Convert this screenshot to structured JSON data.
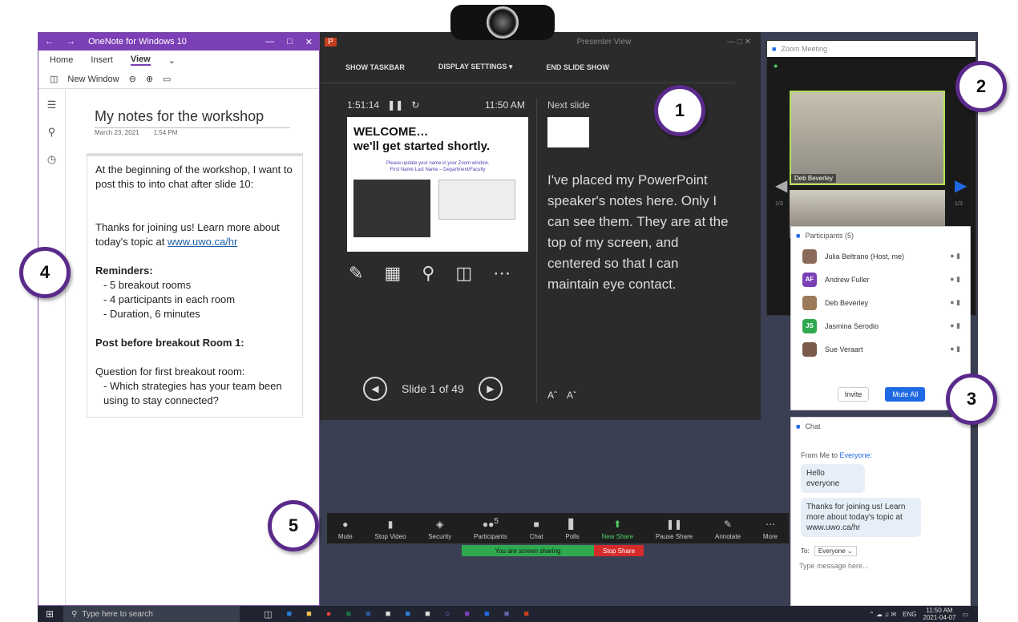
{
  "onenote": {
    "title": "OneNote for Windows 10",
    "menu": [
      "Home",
      "Insert",
      "View"
    ],
    "active_menu": "View",
    "toolbar_new_window": "New Window",
    "note_title": "My notes for the workshop",
    "note_date": "March 23, 2021",
    "note_time": "1:54 PM",
    "body": {
      "p1": "At the beginning of the workshop, I want to post this to into chat after slide 10:",
      "p2a": "Thanks for joining us! Learn more about today's topic at ",
      "p2link": "www.uwo.ca/hr",
      "reminders_heading": "Reminders:",
      "reminders": [
        "5 breakout rooms",
        "4 participants in each room",
        "Duration, 6 minutes"
      ],
      "post_heading": "Post before breakout Room 1:",
      "question_intro": "Question for first breakout room:",
      "questions": [
        "Which strategies has your team been using to stay connected?"
      ]
    }
  },
  "powerpoint": {
    "window_title": "Presenter View",
    "toolbar": [
      "SHOW TASKBAR",
      "DISPLAY SETTINGS ▾",
      "END SLIDE SHOW"
    ],
    "timer": "1:51:14",
    "clock": "11:50 AM",
    "next_slide_label": "Next slide",
    "slide_heading_1": "WELCOME…",
    "slide_heading_2": "we'll get started shortly.",
    "slide_sub_1": "Please update your name in your Zoom window.",
    "slide_sub_2": "First Name Last Name – Department/Faculty",
    "notes": "I've placed my PowerPoint speaker's notes here. Only I can see them. They are at the top of my screen, and centered so that I can maintain eye contact.",
    "slide_counter": "Slide 1 of 49"
  },
  "zoom_meeting": {
    "title": "Zoom Meeting",
    "speaker_name": "Deb Beverley",
    "page_left": "1/3",
    "page_right": "1/3"
  },
  "participants": {
    "title": "Participants (5)",
    "list": [
      {
        "name": "Julia Beltrano (Host, me)",
        "initials": "",
        "color": "#8a6a5a"
      },
      {
        "name": "Andrew Fuller",
        "initials": "AF",
        "color": "#7b3fb6"
      },
      {
        "name": "Deb Beverley",
        "initials": "",
        "color": "#9a7a5a"
      },
      {
        "name": "Jasmina Serodio",
        "initials": "JS",
        "color": "#2fa84f"
      },
      {
        "name": "Sue Veraart",
        "initials": "",
        "color": "#7a5a4a"
      }
    ],
    "invite": "Invite",
    "mute_all": "Mute All"
  },
  "chat": {
    "title": "Chat",
    "from": "From Me to ",
    "to_everyone": "Everyone:",
    "msg1": "Hello everyone",
    "msg2": "Thanks for joining us! Learn more about today's topic at www.uwo.ca/hr",
    "to_label": "To:",
    "to_value": "Everyone ⌄",
    "placeholder": "Type message here..."
  },
  "zoom_toolbar": {
    "buttons": [
      "Mute",
      "Stop Video",
      "Security",
      "Participants",
      "Chat",
      "Polls",
      "New Share",
      "Pause Share",
      "Annotate",
      "More"
    ],
    "participant_count": "5",
    "sharing_text": "You are screen sharing",
    "stop_share": "Stop Share"
  },
  "taskbar": {
    "search_placeholder": "Type here to search",
    "lang": "ENG",
    "time": "11:50 AM",
    "date": "2021-04-07"
  },
  "callouts": [
    "1",
    "2",
    "3",
    "4",
    "5"
  ],
  "colors": {
    "onenote": "#7b3fb6",
    "callout_border": "#5a2a8a",
    "zoom_blue": "#1f6ae2",
    "share_green": "#2fa84f",
    "stop_red": "#d62b2b"
  }
}
